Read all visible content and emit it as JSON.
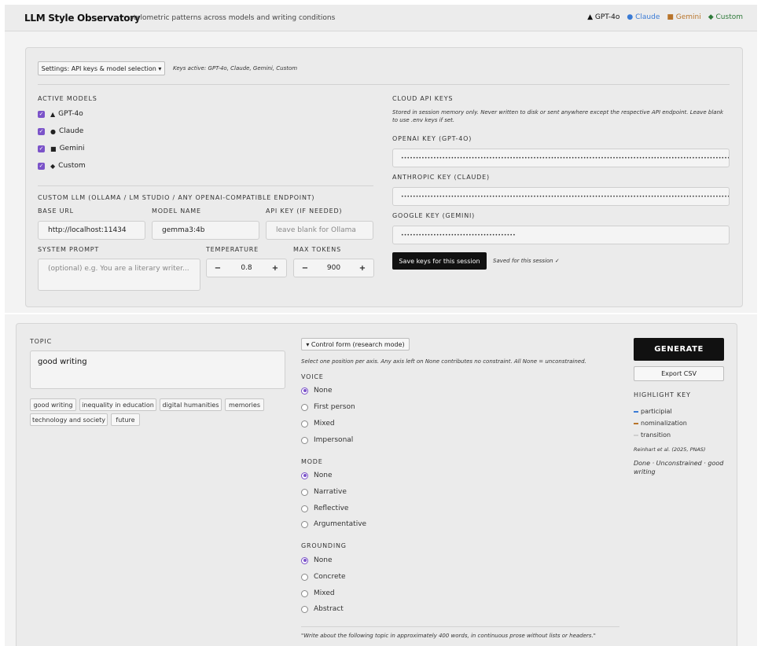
{
  "header": {
    "title": "LLM Style Observatory",
    "subtitle": "stylometric patterns across models and writing conditions",
    "legend": [
      {
        "label": "▲ GPT-4o",
        "color": "#111111"
      },
      {
        "label": "● Claude",
        "color": "#3a7bd5"
      },
      {
        "label": "■ Gemini",
        "color": "#b8742a"
      },
      {
        "label": "◆ Custom",
        "color": "#2f7a3a"
      }
    ]
  },
  "settings": {
    "toggle_label": "Settings: API keys & model selection ▾",
    "keys_active": "Keys active: GPT-4o, Claude, Gemini, Custom",
    "active_models": {
      "label": "ACTIVE MODELS",
      "items": [
        {
          "symbol": "▲",
          "name": "GPT-4o"
        },
        {
          "symbol": "●",
          "name": "Claude"
        },
        {
          "symbol": "■",
          "name": "Gemini"
        },
        {
          "symbol": "◆",
          "name": "Custom"
        }
      ]
    },
    "custom_llm": {
      "label": "CUSTOM LLM (OLLAMA / LM STUDIO / ANY OPENAI-COMPATIBLE ENDPOINT)",
      "base_url_label": "BASE URL",
      "base_url_value": "http://localhost:11434",
      "model_name_label": "MODEL NAME",
      "model_name_value": "gemma3:4b",
      "api_key_label": "API KEY (IF NEEDED)",
      "api_key_placeholder": "leave blank for Ollama",
      "system_prompt_label": "SYSTEM PROMPT",
      "system_prompt_placeholder": "(optional) e.g. You are a literary writer...",
      "temperature_label": "TEMPERATURE",
      "temperature_value": "0.8",
      "max_tokens_label": "MAX TOKENS",
      "max_tokens_value": "900",
      "minus": "−",
      "plus": "+"
    },
    "cloud": {
      "label": "CLOUD API KEYS",
      "note": "Stored in session memory only. Never written to disk or sent anywhere except the respective API endpoint. Leave blank to use .env keys if set.",
      "openai_label": "OPENAI KEY (GPT-4O)",
      "openai_value": "••••••••••••••••••••••••••••••••••••••••••••••••••••••••••••••••••••••••••••••••••••••••••••••••••••••••••••••••••••••••••••••••••••••••••••••••••••••",
      "anthropic_label": "ANTHROPIC KEY (CLAUDE)",
      "anthropic_value": "••••••••••••••••••••••••••••••••••••••••••••••••••••••••••••••••••••••••••••••••••••••••••••••••••••••••••••••••••••••••••••••••••••••",
      "google_label": "GOOGLE KEY (GEMINI)",
      "google_value": "•••••••••••••••••••••••••••••••••••••••",
      "save_label": "Save keys for this session",
      "saved_status": "Saved for this session ✓"
    }
  },
  "topic": {
    "label": "TOPIC",
    "value": "good writing",
    "chips": [
      "good writing",
      "inequality in education",
      "digital humanities",
      "memories",
      "technology and society",
      "future"
    ]
  },
  "control": {
    "toggle_label": "▾ Control form (research mode)",
    "instructions": "Select one position per axis. Any axis left on None contributes no constraint. All None = unconstrained.",
    "axes": [
      {
        "label": "VOICE",
        "options": [
          "None",
          "First person",
          "Mixed",
          "Impersonal"
        ],
        "selected": 0
      },
      {
        "label": "MODE",
        "options": [
          "None",
          "Narrative",
          "Reflective",
          "Argumentative"
        ],
        "selected": 0
      },
      {
        "label": "GROUNDING",
        "options": [
          "None",
          "Concrete",
          "Mixed",
          "Abstract"
        ],
        "selected": 0
      }
    ],
    "prompt_preview": "\"Write about the following topic in approximately 400 words, in continuous prose without lists or headers.\""
  },
  "actions": {
    "generate_label": "GENERATE",
    "export_label": "Export CSV"
  },
  "highlight": {
    "label": "HIGHLIGHT KEY",
    "items": [
      {
        "label": "participial",
        "color": "#3a7bd5"
      },
      {
        "label": "nominalization",
        "color": "#b8742a"
      },
      {
        "label": "transition",
        "color": "#cfcfcf"
      }
    ],
    "citation": "Reinhart et al. (2025, PNAS)",
    "status": "Done · Unconstrained · good writing"
  }
}
